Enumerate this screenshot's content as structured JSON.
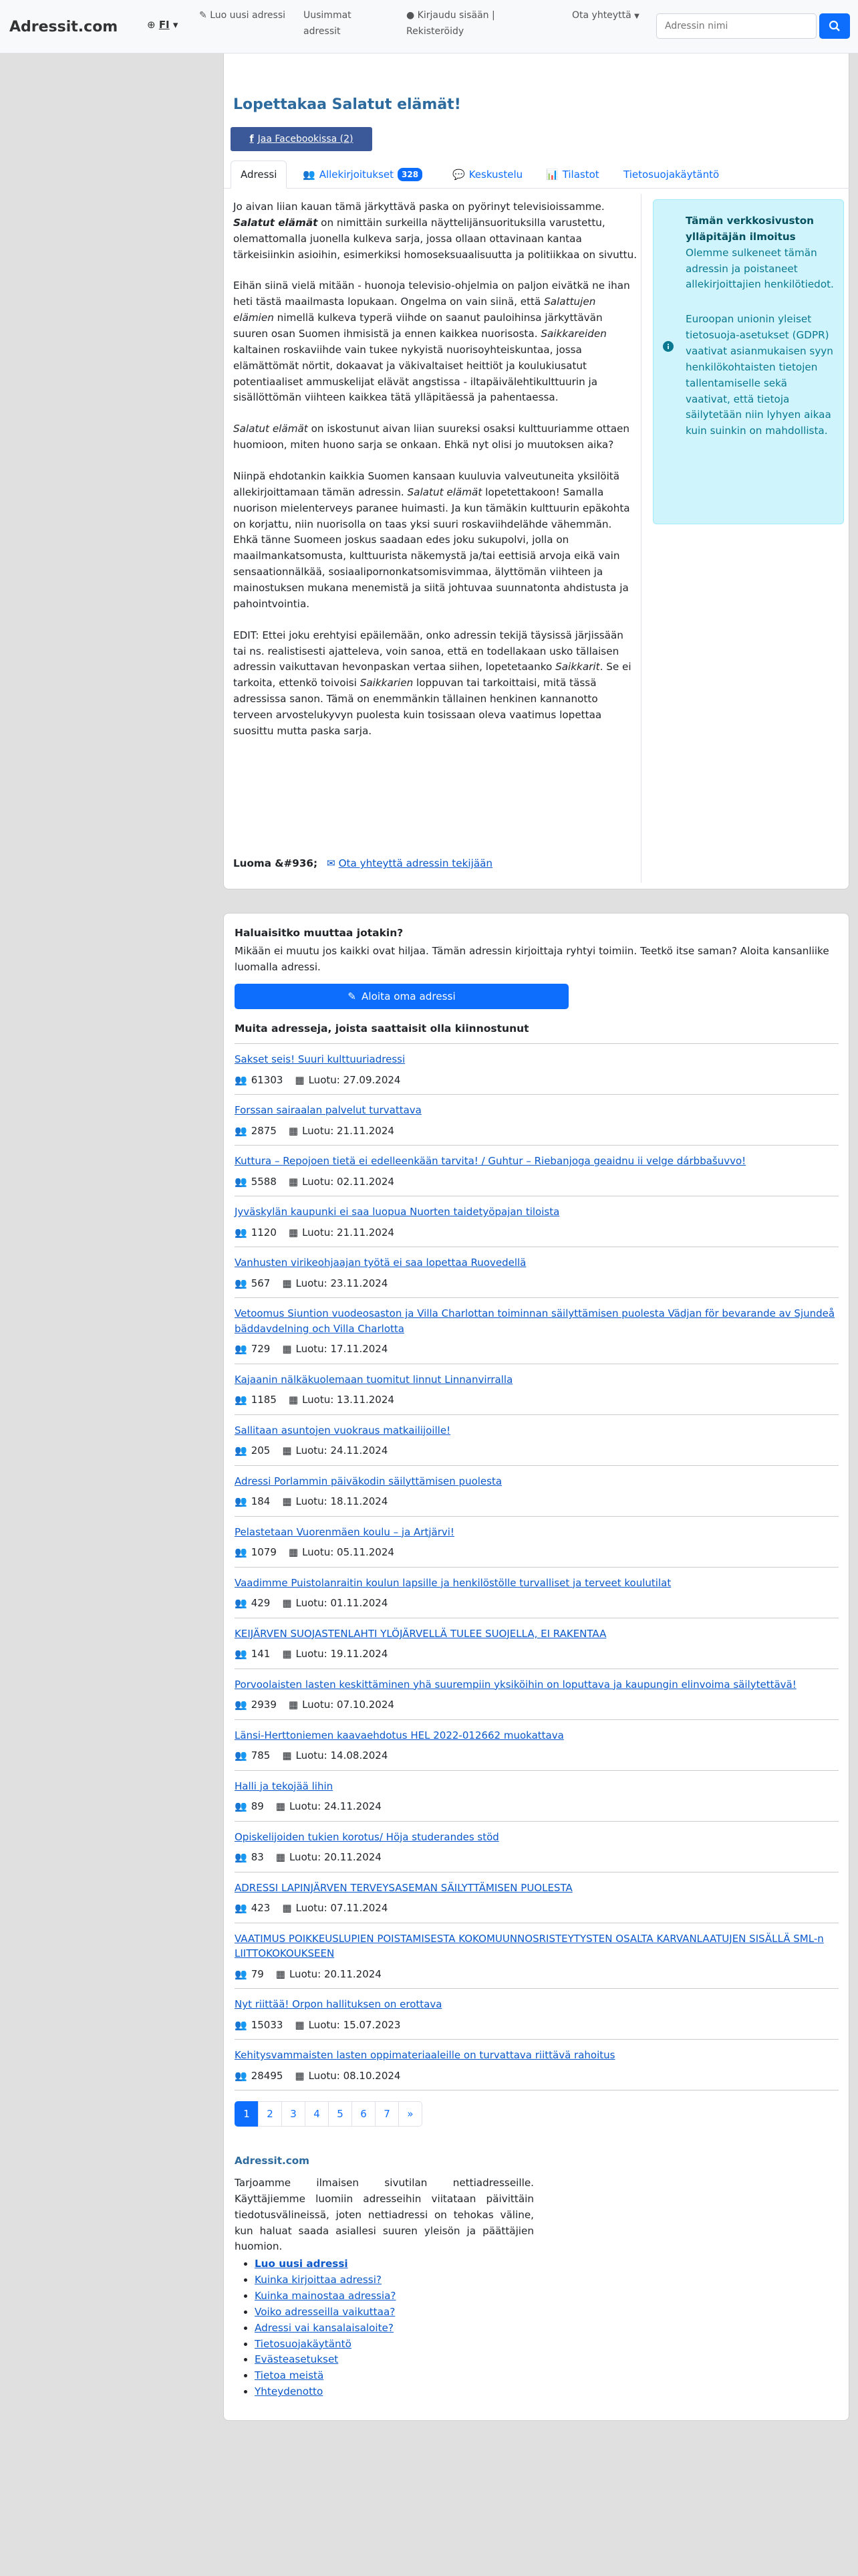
{
  "navbar": {
    "brand": "Adressit.com",
    "lang": "FI",
    "new_address": "Luo uusi adressi",
    "latest": "Uusimmat adressit",
    "login": "Kirjaudu sisään | Rekisteröidy",
    "contact": "Ota yhteyttä",
    "search_placeholder": "Adressin nimi"
  },
  "address": {
    "title": "Lopettakaa Salatut elämät!",
    "share": "Jaa Facebookissa (2)",
    "tabs": {
      "address": "Adressi",
      "signatures": "Allekirjoitukset",
      "signature_count": "328",
      "discussion": "Keskustelu",
      "stats": "Tilastot",
      "privacy": "Tietosuojakäytäntö"
    },
    "p1_a": "Jo aivan liian kauan tämä järkyttävä paska on pyörinyt televisioissamme. ",
    "p1_em": "Salatut elämät",
    "p1_b": " on nimittäin surkeilla näyttelijänsuorituksilla varustettu, olemattomalla juonella kulkeva sarja, jossa ollaan ottavinaan kantaa tärkeisiinkin asioihin, esimerkiksi homoseksuaalisuutta ja politiikkaa on sivuttu.",
    "p2_a": "Eihän siinä vielä mitään - huonoja televisio-ohjelmia on paljon eivätkä ne ihan heti tästä maailmasta lopukaan. Ongelma on vain siinä, että ",
    "p2_em1": "Salattujen elämien",
    "p2_b": " nimellä kulkeva typerä viihde on saanut pauloihinsa järkyttävän suuren osan Suomen ihmisistä ja ennen kaikkea nuorisosta. ",
    "p2_em2": "Saikkareiden",
    "p2_c": " kaltainen roskaviihde vain tukee nykyistä nuorisoyhteiskuntaa, jossa elämättömät nörtit, dokaavat ja väkivaltaiset heittiöt ja koulukiusatut potentiaaliset ammuskelijat elävät angstissa - iltapäivälehtikulttuurin ja sisällöttömän viihteen kaikkea tätä ylläpitäessä ja pahentaessa.",
    "p3_em": "Salatut elämät",
    "p3_b": " on iskostunut aivan liian suureksi osaksi kulttuuriamme ottaen huomioon, miten huono sarja se onkaan. Ehkä nyt olisi jo muutoksen aika?",
    "p4_a": "Niinpä ehdotankin kaikkia Suomen kansaan kuuluvia valveutuneita yksilöitä allekirjoittamaan tämän adressin. ",
    "p4_em": "Salatut elämät",
    "p4_b": " lopetettakoon! Samalla nuorison mielenterveys paranee huimasti. Ja kun tämäkin kulttuurin epäkohta on korjattu, niin nuorisolla on taas yksi suuri roskaviihdelähde vähemmän. Ehkä tänne Suomeen joskus saadaan edes joku sukupolvi, jolla on maailmankatsomusta, kulttuurista näkemystä ja/tai eettisiä arvoja eikä vain sensaationnälkää, sosiaalipornonkatsomisvimmaa, älyttömän viihteen ja mainostuksen mukana menemistä ja siitä johtuvaa suunnatonta ahdistusta ja pahointvointia.",
    "p5_a": "EDIT: Ettei joku erehtyisi epäilemään, onko adressin tekijä täysissä järjissään tai ns. realistisesti ajatteleva, voin sanoa, että en todellakaan usko tällaisen adressin vaikuttavan hevonpaskan vertaa siihen, lopetetaanko ",
    "p5_em1": "Saikkarit",
    "p5_b": ". Se ei tarkoita, ettenkö toivoisi ",
    "p5_em2": "Saikkarien",
    "p5_c": " loppuvan tai tarkoittaisi, mitä tässä adressissa sanon. Tämä on enemmänkin tällainen henkinen kannanotto terveen arvostelukyvyn puolesta kuin tosissaan oleva vaatimus lopettaa suosittu mutta paska sarja.",
    "author_label": "Luoma &#936;",
    "contact_author": "Ota yhteyttä adressin tekijään"
  },
  "notice": {
    "heading": "Tämän verkkosivuston ylläpitäjän ilmoitus",
    "text1": "Olemme sulkeneet tämän adressin ja poistaneet allekirjoittajien henkilötiedot.",
    "text2": "Euroopan unionin yleiset tietosuoja-asetukset (GDPR) vaativat asianmukaisen syyn henkilökohtaisten tietojen tallentamiselle sekä vaativat, että tietoja säilytetään niin lyhyen aikaa kuin suinkin on mahdollista."
  },
  "change": {
    "heading": "Haluaisitko muuttaa jotakin?",
    "text": "Mikään ei muutu jos kaikki ovat hiljaa. Tämän adressin kirjoittaja ryhtyi toimiin. Teetkö itse saman? Aloita kansanliike luomalla adressi.",
    "button": "Aloita oma adressi",
    "list_heading": "Muita adresseja, joista saattaisit olla kiinnostunut"
  },
  "others": [
    {
      "title": "Sakset seis! Suuri kulttuuriadressi",
      "count": "61303",
      "date": "Luotu: 27.09.2024"
    },
    {
      "title": "Forssan sairaalan palvelut turvattava",
      "count": "2875",
      "date": "Luotu: 21.11.2024"
    },
    {
      "title": "Kuttura – Repojoen tietä ei edelleenkään tarvita! / Guhtur – Riebanjoga geaidnu ii velge dárbbašuvvo!",
      "count": "5588",
      "date": "Luotu: 02.11.2024"
    },
    {
      "title": "Jyväskylän kaupunki ei saa luopua Nuorten taidetyöpajan tiloista",
      "count": "1120",
      "date": "Luotu: 21.11.2024"
    },
    {
      "title": "Vanhusten virikeohjaajan työtä ei saa lopettaa Ruovedellä",
      "count": "567",
      "date": "Luotu: 23.11.2024"
    },
    {
      "title": "Vetoomus Siuntion vuodeosaston ja Villa Charlottan toiminnan säilyttämisen puolesta Vädjan för bevarande av Sjundeå bäddavdelning och Villa Charlotta",
      "count": "729",
      "date": "Luotu: 17.11.2024"
    },
    {
      "title": "Kajaanin nälkäkuolemaan tuomitut linnut Linnanvirralla",
      "count": "1185",
      "date": "Luotu: 13.11.2024"
    },
    {
      "title": "Sallitaan asuntojen vuokraus matkailijoille!",
      "count": "205",
      "date": "Luotu: 24.11.2024"
    },
    {
      "title": "Adressi Porlammin päiväkodin säilyttämisen puolesta",
      "count": "184",
      "date": "Luotu: 18.11.2024"
    },
    {
      "title": "Pelastetaan Vuorenmäen koulu – ja Artjärvi!",
      "count": "1079",
      "date": "Luotu: 05.11.2024"
    },
    {
      "title": "Vaadimme Puistolanraitin koulun lapsille ja henkilöstölle turvalliset ja terveet koulutilat",
      "count": "429",
      "date": "Luotu: 01.11.2024"
    },
    {
      "title": "KEIJÄRVEN SUOJASTENLAHTI YLÖJÄRVELLÄ TULEE SUOJELLA, EI RAKENTAA",
      "count": "141",
      "date": "Luotu: 19.11.2024"
    },
    {
      "title": "Porvoolaisten lasten keskittäminen yhä suurempiin yksiköihin on loputtava ja kaupungin elinvoima säilytettävä!",
      "count": "2939",
      "date": "Luotu: 07.10.2024"
    },
    {
      "title": "Länsi-Herttoniemen kaavaehdotus HEL 2022-012662 muokattava",
      "count": "785",
      "date": "Luotu: 14.08.2024"
    },
    {
      "title": "Halli ja tekojää lihin",
      "count": "89",
      "date": "Luotu: 24.11.2024"
    },
    {
      "title": "Opiskelijoiden tukien korotus/ Höja studerandes stöd",
      "count": "83",
      "date": "Luotu: 20.11.2024"
    },
    {
      "title": "ADRESSI LAPINJÄRVEN TERVEYSASEMAN SÄILYTTÄMISEN PUOLESTA",
      "count": "423",
      "date": "Luotu: 07.11.2024"
    },
    {
      "title": "VAATIMUS POIKKEUSLUPIEN POISTAMISESTA KOKOMUUNNOSRISTEYTYSTEN OSALTA KARVANLAATUJEN SISÄLLÄ SML-n LIITTOKOKOUKSEEN",
      "count": "79",
      "date": "Luotu: 20.11.2024"
    },
    {
      "title": "Nyt riittää! Orpon hallituksen on erottava",
      "count": "15033",
      "date": "Luotu: 15.07.2023"
    },
    {
      "title": "Kehitysvammaisten lasten oppimateriaaleille on turvattava riittävä rahoitus",
      "count": "28495",
      "date": "Luotu: 08.10.2024"
    }
  ],
  "pagination": [
    "1",
    "2",
    "3",
    "4",
    "5",
    "6",
    "7",
    "»"
  ],
  "footer": {
    "title": "Adressit.com",
    "text": "Tarjoamme ilmaisen sivutilan nettiadresseille. Käyttäjiemme luomiin adresseihin viitataan päivittäin tiedotusvälineissä, joten nettiadressi on tehokas väline, kun haluat saada asiallesi suuren yleisön ja päättäjien huomion.",
    "links": [
      "Luo uusi adressi",
      "Kuinka kirjoittaa adressi?",
      "Kuinka mainostaa adressia?",
      "Voiko adresseilla vaikuttaa?",
      "Adressi vai kansalaisaloite?",
      "Tietosuojakäytäntö",
      "Evästeasetukset",
      "Tietoa meistä",
      "Yhteydenotto"
    ]
  },
  "colors": {
    "primary": "#0d6efd",
    "facebook": "#3b5998",
    "notice_bg": "#cff4fc",
    "title": "#2d6a9e"
  },
  "icons": [
    "edit-icon",
    "user-icon",
    "search-icon",
    "facebook-icon",
    "users-icon",
    "comments-icon",
    "chart-icon",
    "info-icon",
    "envelope-icon",
    "calendar-icon"
  ]
}
